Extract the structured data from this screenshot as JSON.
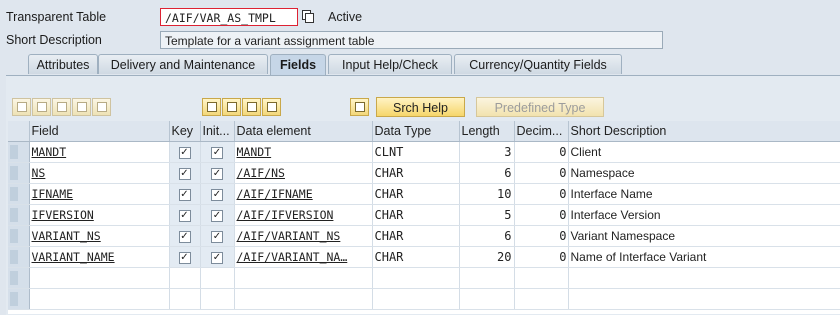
{
  "header": {
    "table_label": "Transparent Table",
    "table_name": "/AIF/VAR_AS_TMPL",
    "status": "Active",
    "desc_label": "Short Description",
    "description": "Template for a variant assignment table"
  },
  "tabs": [
    {
      "label": "Attributes"
    },
    {
      "label": "Delivery and Maintenance"
    },
    {
      "label": "Fields"
    },
    {
      "label": "Input Help/Check"
    },
    {
      "label": "Currency/Quantity Fields"
    }
  ],
  "toolbar": {
    "srch_help": "Srch Help",
    "predefined_type": "Predefined Type"
  },
  "columns": [
    "Field",
    "Key",
    "Init...",
    "Data element",
    "Data Type",
    "Length",
    "Decim...",
    "Short Description"
  ],
  "rows": [
    {
      "field": "MANDT",
      "key": true,
      "init": true,
      "element": "MANDT",
      "type": "CLNT",
      "length": "3",
      "decimals": "0",
      "desc": "Client"
    },
    {
      "field": "NS",
      "key": true,
      "init": true,
      "element": "/AIF/NS",
      "type": "CHAR",
      "length": "6",
      "decimals": "0",
      "desc": "Namespace"
    },
    {
      "field": "IFNAME",
      "key": true,
      "init": true,
      "element": "/AIF/IFNAME",
      "type": "CHAR",
      "length": "10",
      "decimals": "0",
      "desc": "Interface Name"
    },
    {
      "field": "IFVERSION",
      "key": true,
      "init": true,
      "element": "/AIF/IFVERSION",
      "type": "CHAR",
      "length": "5",
      "decimals": "0",
      "desc": "Interface Version"
    },
    {
      "field": "VARIANT_NS",
      "key": true,
      "init": true,
      "element": "/AIF/VARIANT_NS",
      "type": "CHAR",
      "length": "6",
      "decimals": "0",
      "desc": "Variant Namespace"
    },
    {
      "field": "VARIANT_NAME",
      "key": true,
      "init": true,
      "element": "/AIF/VARIANT_NA…",
      "type": "CHAR",
      "length": "20",
      "decimals": "0",
      "desc": "Name of Interface Variant"
    }
  ]
}
